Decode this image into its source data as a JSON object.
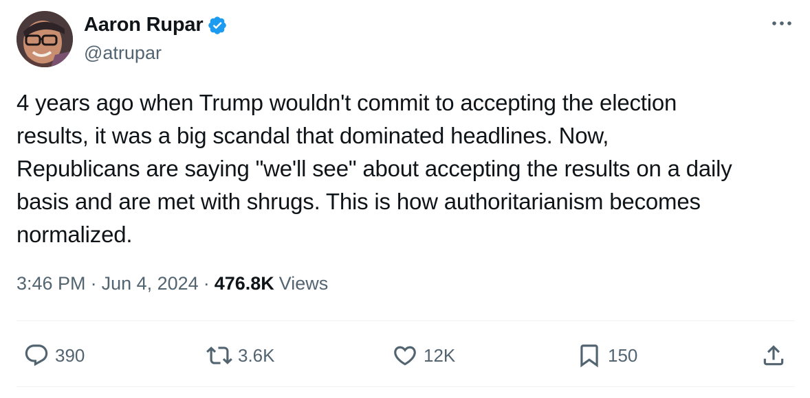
{
  "author": {
    "display_name": "Aaron Rupar",
    "handle": "@atrupar",
    "verified_icon": "verified-badge-icon",
    "verified_color": "#1d9bf0"
  },
  "tweet": {
    "text": "4 years ago when Trump wouldn't commit to accepting the election\nresults, it was a big scandal that dominated headlines. Now,\nRepublicans are saying \"we'll see\" about accepting the results on a daily\nbasis and are met with shrugs. This is how authoritarianism becomes\nnormalized.",
    "time": "3:46 PM",
    "date": "Jun 4, 2024",
    "separator": "·",
    "views_count": "476.8K",
    "views_label": "Views"
  },
  "actions": {
    "reply": {
      "icon": "reply-icon",
      "count": "390"
    },
    "retweet": {
      "icon": "retweet-icon",
      "count": "3.6K"
    },
    "like": {
      "icon": "heart-icon",
      "count": "12K"
    },
    "bookmark": {
      "icon": "bookmark-icon",
      "count": "150"
    },
    "share": {
      "icon": "share-icon"
    }
  },
  "more_menu_icon": "more-options-icon",
  "colors": {
    "text_primary": "#0f1419",
    "text_secondary": "#536471",
    "divider": "#eff3f4",
    "accent": "#1d9bf0"
  }
}
